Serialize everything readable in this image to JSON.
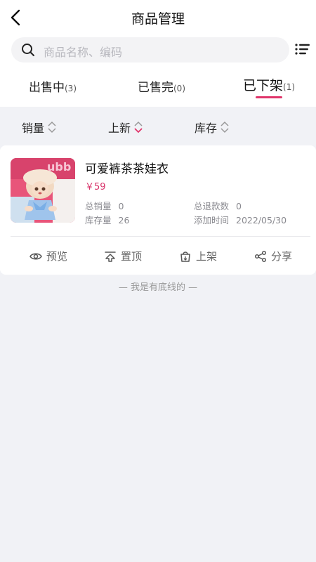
{
  "header": {
    "title": "商品管理"
  },
  "search": {
    "placeholder": "商品名称、编码"
  },
  "tabs": [
    {
      "label": "出售中",
      "count": "(3)"
    },
    {
      "label": "已售完",
      "count": "(0)"
    },
    {
      "label": "已下架",
      "count": "(1)"
    }
  ],
  "sort": [
    {
      "label": "销量"
    },
    {
      "label": "上新"
    },
    {
      "label": "库存"
    }
  ],
  "product": {
    "name": "可爱裤茶茶娃衣",
    "price": "￥59",
    "total_sales_label": "总销量",
    "total_sales": "0",
    "stock_label": "库存量",
    "stock": "26",
    "refunds_label": "总退款数",
    "refunds": "0",
    "added_label": "添加时间",
    "added": "2022/05/30",
    "thumbnail_text": "ubb",
    "actions": [
      {
        "label": "预览",
        "icon": "eye-icon"
      },
      {
        "label": "置顶",
        "icon": "pin-top-icon"
      },
      {
        "label": "上架",
        "icon": "shelve-bag-icon"
      },
      {
        "label": "分享",
        "icon": "share-icon"
      }
    ]
  },
  "footer": {
    "text": "— 我是有底线的 —"
  },
  "colors": {
    "accent": "#e0356a",
    "price": "#d8336a",
    "background": "#f1f2f6"
  }
}
